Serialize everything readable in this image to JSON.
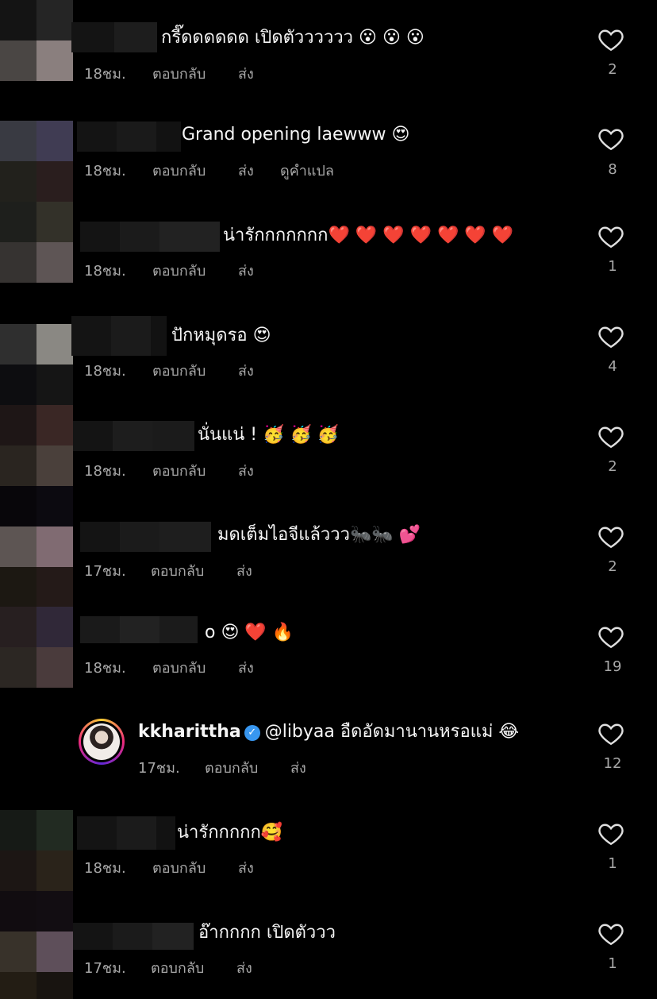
{
  "labels": {
    "reply": "ตอบกลับ",
    "send": "ส่ง",
    "translate": "ดูคำแปล"
  },
  "icons": {
    "like": "heart-outline-icon",
    "verified": "verified-badge-icon"
  },
  "colors": {
    "background": "#000000",
    "text": "#f5f5f5",
    "meta": "#a8a8a8",
    "verified": "#3897f0"
  },
  "comments": [
    {
      "text": "กรี๊ดดดดดด เปิดตัวววววว 😮 😮 😮",
      "time": "18ชม.",
      "likes": "2"
    },
    {
      "text": "Grand opening laewww 😍",
      "time": "18ชม.",
      "likes": "8"
    },
    {
      "text": "น่ารักกกกกกก❤️ ❤️ ❤️ ❤️ ❤️ ❤️ ❤️",
      "time": "18ชม.",
      "likes": "1"
    },
    {
      "text": "ปักหมุดรอ 😍",
      "time": "18ชม.",
      "likes": "4"
    },
    {
      "text": "นั่นแน่ ! 🥳 🥳 🥳",
      "time": "18ชม.",
      "likes": "2"
    },
    {
      "text": "มดเต็มไอจีแล้ววว🐜🐜 💕",
      "time": "17ชม.",
      "likes": "2"
    },
    {
      "text": "o 😍 ❤️ 🔥",
      "time": "18ชม.",
      "likes": "19"
    },
    {
      "username": "kkharittha",
      "text": "@libyaa อืดอัดมานานหรอแม่ 😂",
      "time": "17ชม.",
      "likes": "12"
    },
    {
      "text": "น่ารักกกกก🥰",
      "time": "18ชม.",
      "likes": "1"
    },
    {
      "text": "อ๊ากกกก เปิดตัววว",
      "time": "17ชม.",
      "likes": "1"
    }
  ]
}
